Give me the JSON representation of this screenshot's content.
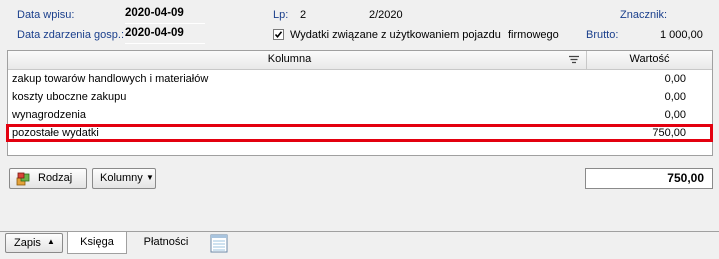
{
  "header": {
    "data_wpisu_label": "Data wpisu:",
    "data_wpisu_value": "2020-04-09",
    "data_zdarzenia_label": "Data zdarzenia gosp.:",
    "data_zdarzenia_value": "2020-04-09",
    "lp_label": "Lp:",
    "lp_value": "2",
    "doc_number": "2/2020",
    "znacznik_label": "Znacznik:",
    "vehicle_checkbox_label": "Wydatki związane z użytkowaniem pojazdu",
    "vehicle_checkbox_checked": true,
    "vehicle_type": "firmowego",
    "brutto_label": "Brutto:",
    "brutto_value": "1 000,00"
  },
  "table": {
    "columns": [
      "Kolumna",
      "Wartość"
    ],
    "rows": [
      {
        "name": "zakup towarów handlowych i materiałów",
        "value": "0,00"
      },
      {
        "name": "koszty uboczne zakupu",
        "value": "0,00"
      },
      {
        "name": "wynagrodzenia",
        "value": "0,00"
      },
      {
        "name": "pozostałe wydatki",
        "value": "750,00"
      }
    ],
    "highlight_color": "#e3000f"
  },
  "toolbar": {
    "rodzaj_label": "Rodzaj",
    "kolumny_label": "Kolumny",
    "total_value": "750,00"
  },
  "bottom": {
    "zapis_label": "Zapis",
    "tabs": [
      "Księga",
      "Płatności"
    ]
  }
}
